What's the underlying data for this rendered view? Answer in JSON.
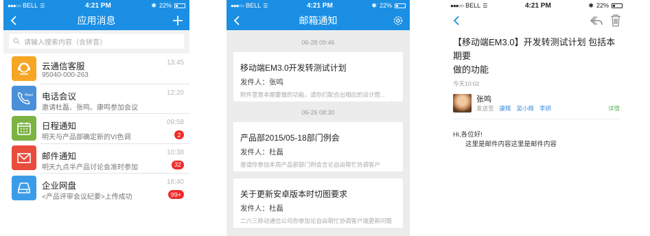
{
  "status": {
    "carrier": "BELL",
    "time": "4:21 PM",
    "battery": "22%"
  },
  "screen1": {
    "title": "应用消息",
    "search_placeholder": "请输入搜索内容（含拼音）",
    "messages": [
      {
        "title": "云通信客服",
        "sub": "95040-000-263",
        "time": "13:45",
        "badge": "",
        "color": "#f5a623",
        "icon": "headset-icon"
      },
      {
        "title": "电话会议",
        "sub": "邀请杜磊、张鸣、康鸣参加会议",
        "time": "12:20",
        "badge": "",
        "color": "#4a90d9",
        "icon": "meet-phone-icon"
      },
      {
        "title": "日程通知",
        "sub": "明天与产品部确定新的VI色调",
        "time": "09:58",
        "badge": "2",
        "color": "#7cb342",
        "icon": "calendar-icon"
      },
      {
        "title": "邮件通知",
        "sub": "明天九点半产品讨论会准时参加",
        "time": "10:38",
        "badge": "32",
        "color": "#e84c3d",
        "icon": "mail-icon"
      },
      {
        "title": "企业网盘",
        "sub": "<产品评审会议纪要>上传成功",
        "time": "16:40",
        "badge": "99+",
        "color": "#3b9de8",
        "icon": "cloud-drive-icon"
      }
    ]
  },
  "screen2": {
    "title": "邮箱通知",
    "sender_label": "发件人：",
    "groups": [
      {
        "date": "06-28 09:46",
        "cards": [
          {
            "title": "移动端EM3.0开发转测试计划",
            "sender": "张鸣",
            "snippet": "附件里是本期要做的功能，请你们配合出相应的设计图..."
          }
        ]
      },
      {
        "date": "06-26 08:30",
        "cards": [
          {
            "title": "产品部2015/05-18部门例会",
            "sender": "杜磊",
            "snippet": "邀请你参加本周产品部部门例会言论自由帮忙协调客户"
          },
          {
            "title": "关于更新安卓版本时切图要求",
            "sender": "杜磊",
            "snippet": "二六三移动通信公司你参加论自由帮忙协调客户端更新问题"
          }
        ]
      }
    ]
  },
  "screen3": {
    "subject_line1": "【移动端EM3.0】开发转测试计划 包括本期要",
    "subject_line2": "做的功能",
    "time": "今天10:02",
    "sender": "张鸣",
    "sendto_label": "发送至",
    "recipients": [
      "康辉",
      "吴小辉",
      "李妍"
    ],
    "detail": "详情",
    "greeting": "Hi,各位好!",
    "body": "这里是邮件内容这里是邮件内容"
  }
}
